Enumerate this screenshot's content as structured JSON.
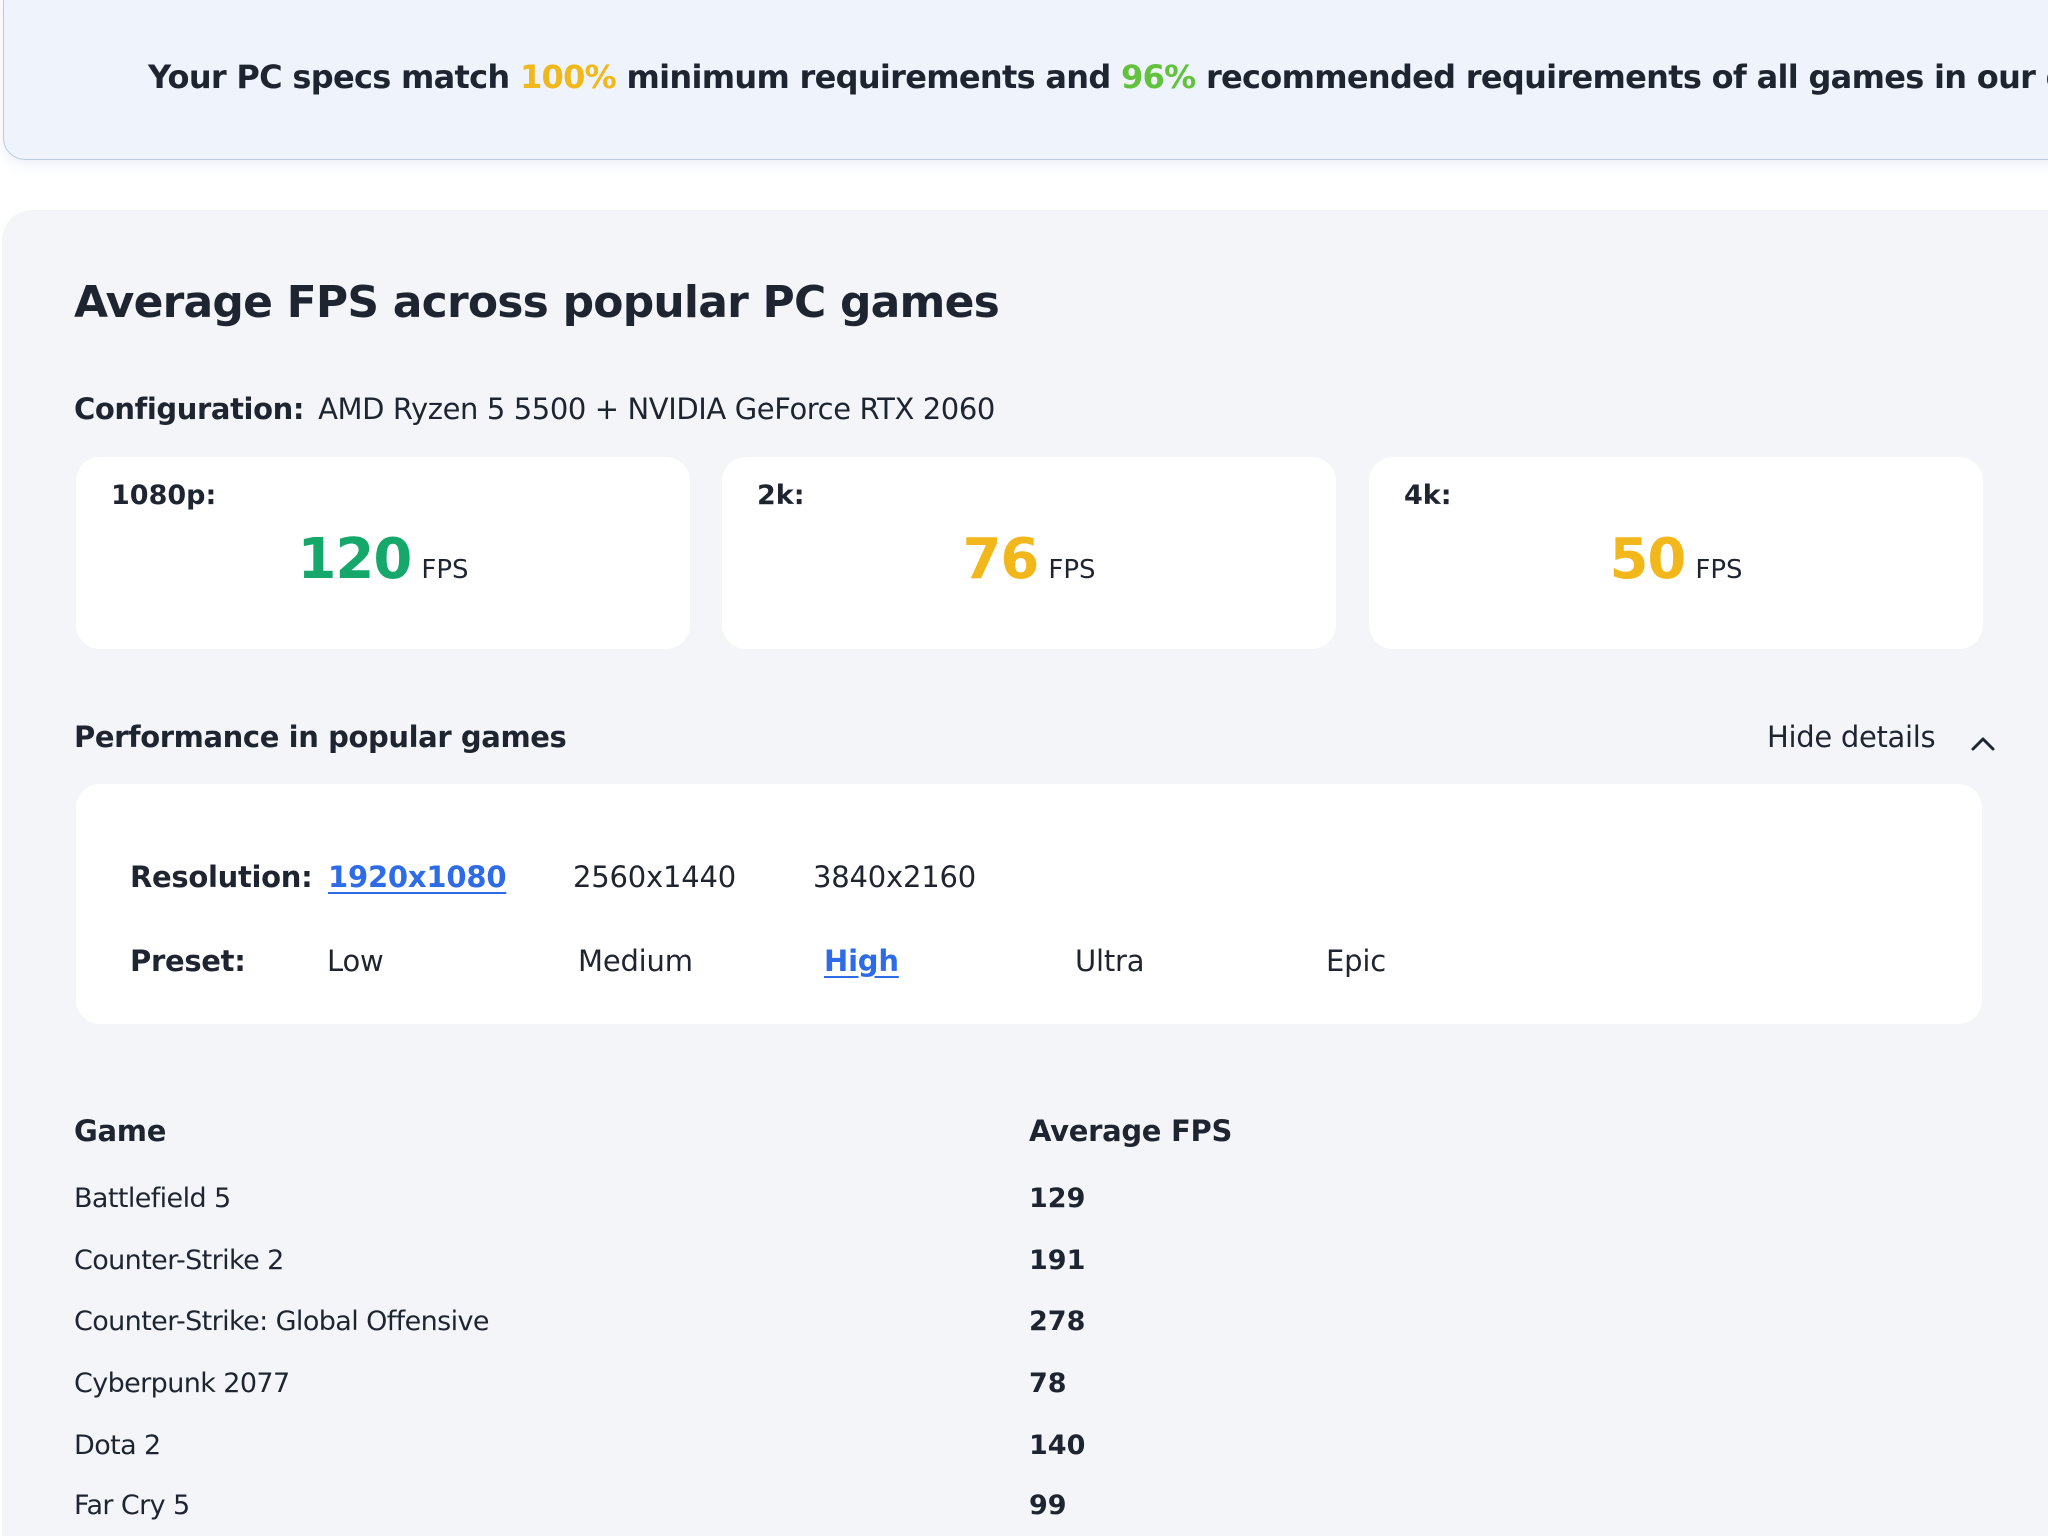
{
  "banner": {
    "prefix": "Your PC specs match ",
    "min_pct": "100%",
    "middle": " minimum requirements and ",
    "rec_pct": "96%",
    "suffix": " recommended requirements of all games in our database."
  },
  "main": {
    "title": "Average FPS across popular PC games",
    "config_label": "Configuration:",
    "config_value": "AMD Ryzen 5 5500 + NVIDIA GeForce RTX 2060"
  },
  "fps_cards": [
    {
      "label": "1080p:",
      "value": "120",
      "unit": "FPS",
      "color": "#16a86b"
    },
    {
      "label": "2k:",
      "value": "76",
      "unit": "FPS",
      "color": "#f2b71a"
    },
    {
      "label": "4k:",
      "value": "50",
      "unit": "FPS",
      "color": "#f2b71a"
    }
  ],
  "performance": {
    "title": "Performance in popular games",
    "toggle_label": "Hide details",
    "toggle_icon": "chevron-up-icon"
  },
  "filters": {
    "resolution_label": "Resolution:",
    "resolutions": [
      "1920x1080",
      "2560x1440",
      "3840x2160"
    ],
    "resolution_selected": "1920x1080",
    "preset_label": "Preset:",
    "presets": [
      "Low",
      "Medium",
      "High",
      "Ultra",
      "Epic"
    ],
    "preset_selected": "High",
    "active_color": "#2e6be6"
  },
  "table": {
    "headers": {
      "game": "Game",
      "fps": "Average FPS"
    },
    "rows": [
      {
        "game": "Battlefield 5",
        "fps": "129"
      },
      {
        "game": "Counter-Strike 2",
        "fps": "191"
      },
      {
        "game": "Counter-Strike: Global Offensive",
        "fps": "278"
      },
      {
        "game": "Cyberpunk 2077",
        "fps": "78"
      },
      {
        "game": "Dota 2",
        "fps": "140"
      },
      {
        "game": "Far Cry 5",
        "fps": "99"
      }
    ]
  }
}
